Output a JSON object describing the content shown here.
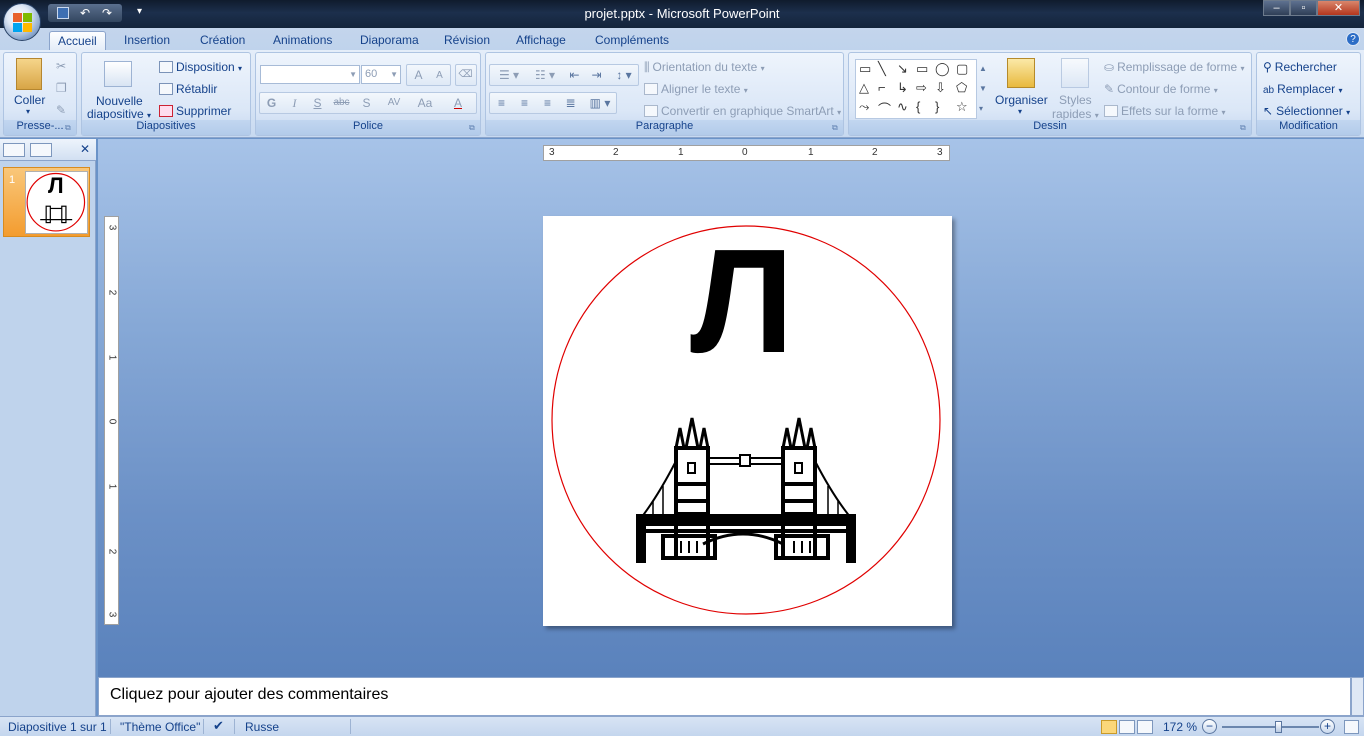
{
  "window": {
    "title": "projet.pptx - Microsoft PowerPoint",
    "controls": [
      "minimize",
      "restore",
      "close"
    ]
  },
  "quick_access": [
    "save-icon",
    "undo-icon",
    "redo-icon",
    "customize-icon"
  ],
  "tabs": [
    {
      "label": "Accueil",
      "active": true
    },
    {
      "label": "Insertion"
    },
    {
      "label": "Création"
    },
    {
      "label": "Animations"
    },
    {
      "label": "Diaporama"
    },
    {
      "label": "Révision"
    },
    {
      "label": "Affichage"
    },
    {
      "label": "Compléments"
    }
  ],
  "ribbon": {
    "clipboard": {
      "label": "Presse-...",
      "paste": "Coller"
    },
    "slides": {
      "label": "Diapositives",
      "new_slide_1": "Nouvelle",
      "new_slide_2": "diapositive",
      "layout": "Disposition",
      "reset": "Rétablir",
      "delete": "Supprimer"
    },
    "font": {
      "label": "Police",
      "font_name": "",
      "font_size": "60",
      "bold": "G",
      "italic": "I",
      "underline": "S",
      "strike": "abc",
      "shadow": "S",
      "spacing": "AV",
      "case": "Aa",
      "grow": "A",
      "shrink": "A",
      "color": "A"
    },
    "paragraph": {
      "label": "Paragraphe",
      "text_direction": "Orientation du texte",
      "align_text": "Aligner le texte",
      "smartart": "Convertir en graphique SmartArt"
    },
    "drawing": {
      "label": "Dessin",
      "arrange": "Organiser",
      "quick_styles_1": "Styles",
      "quick_styles_2": "rapides",
      "shape_fill": "Remplissage de forme",
      "shape_outline": "Contour de forme",
      "shape_effects": "Effets sur la forme"
    },
    "editing": {
      "label": "Modification",
      "find": "Rechercher",
      "replace": "Remplacer",
      "select": "Sélectionner"
    }
  },
  "slide_panel": {
    "slide_number": "1"
  },
  "rulers": {
    "horizontal": [
      "3",
      "2",
      "1",
      "0",
      "1",
      "2",
      "3"
    ],
    "vertical": [
      "3",
      "2",
      "1",
      "0",
      "1",
      "2",
      "3"
    ]
  },
  "slide": {
    "letter": "Л",
    "circle_color": "#e00000",
    "image": "tower-bridge-icon"
  },
  "notes": {
    "placeholder": "Cliquez pour ajouter des commentaires"
  },
  "status": {
    "slide_info": "Diapositive 1 sur 1",
    "theme": "\"Thème Office\"",
    "language": "Russe",
    "zoom": "172 %"
  },
  "colors": {
    "accent": "#15428b",
    "ribbon": "#dbe7f7",
    "active_thumb": "#f39c2f"
  }
}
